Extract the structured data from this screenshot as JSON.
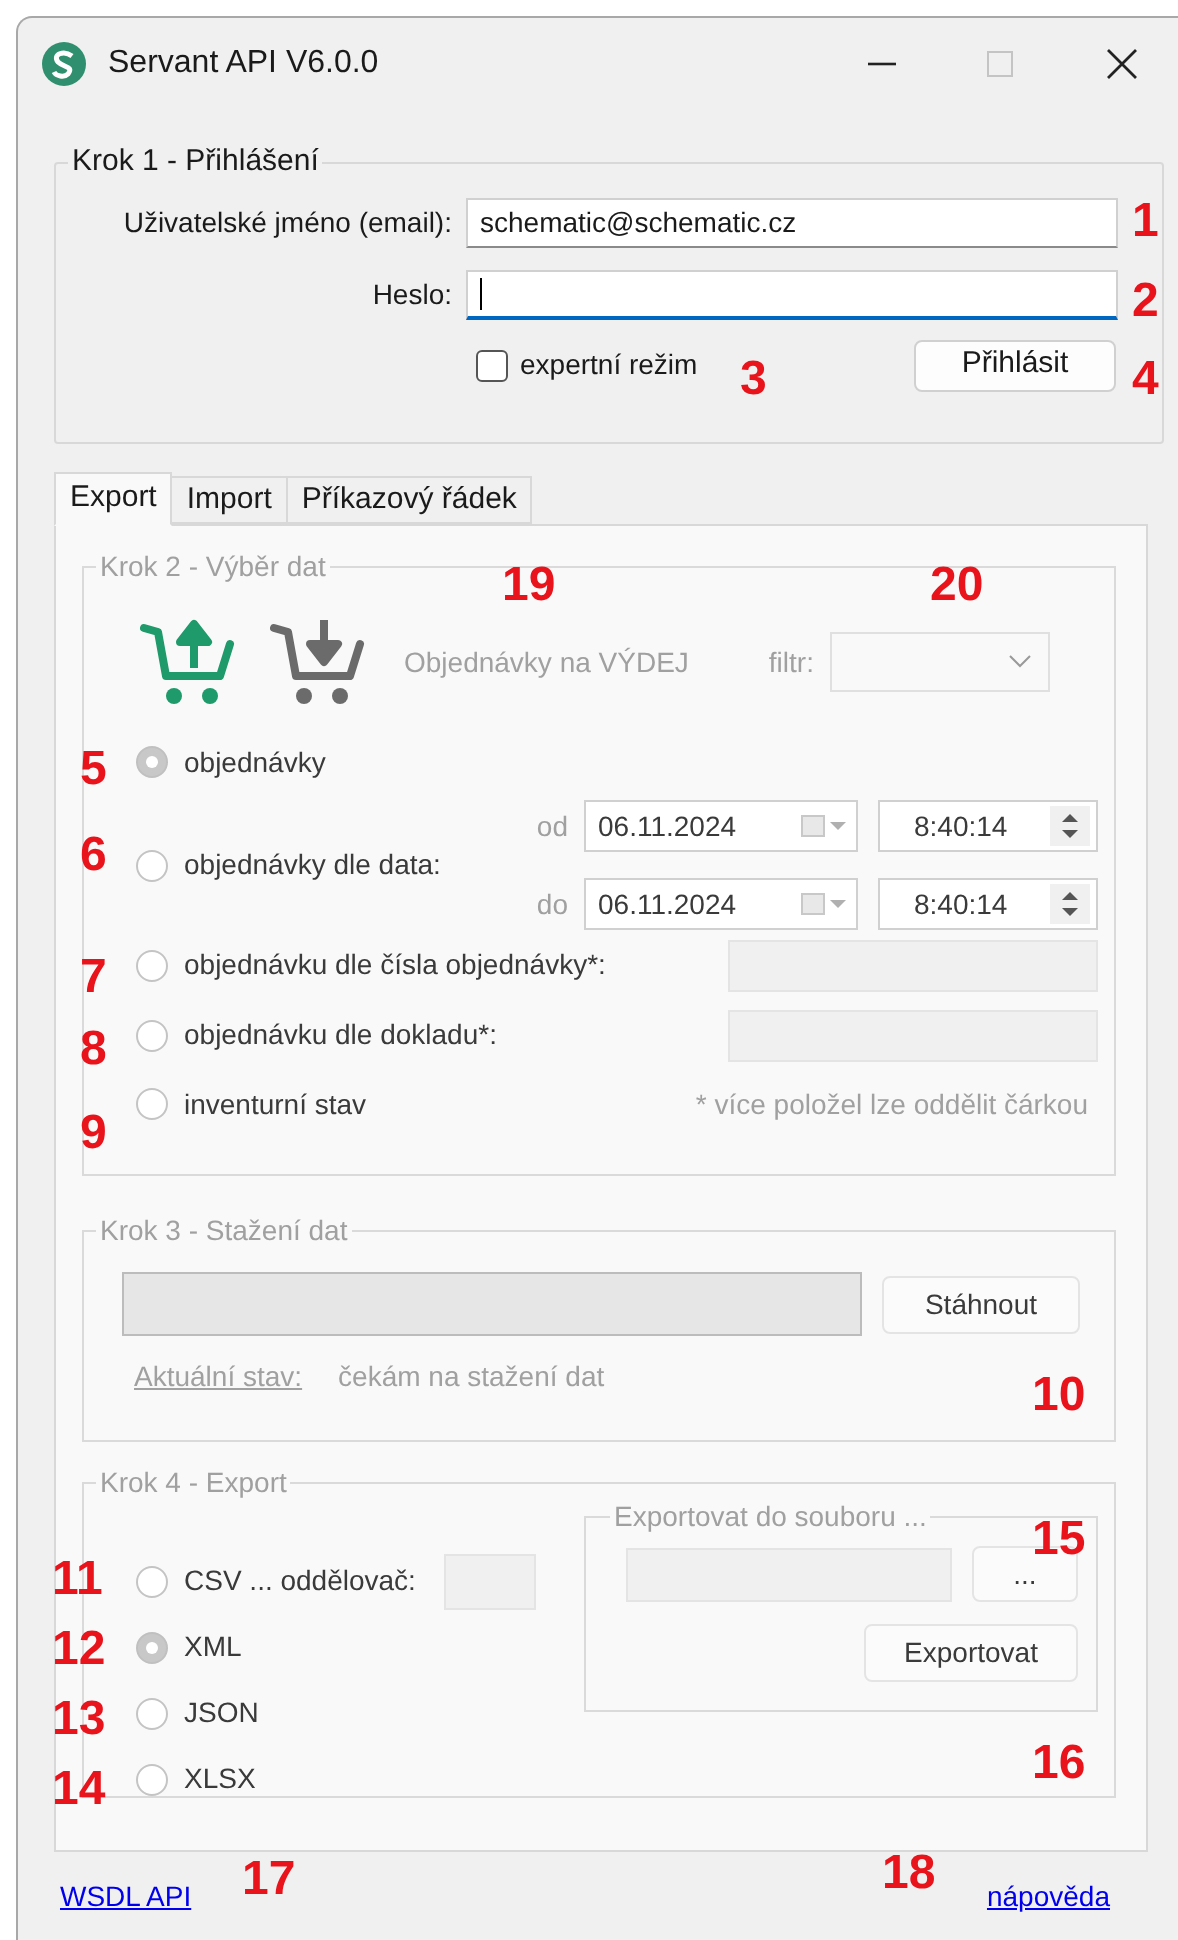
{
  "window": {
    "title": "Servant API V6.0.0"
  },
  "login": {
    "legend": "Krok 1 - Přihlášení",
    "username_label": "Uživatelské jméno (email):",
    "username_value": "schematic@schematic.cz",
    "password_label": "Heslo:",
    "password_focused": true,
    "expert": {
      "label": "expertní režim",
      "checked": false
    },
    "login_button": "Přihlásit"
  },
  "tabs": [
    {
      "label": "Export",
      "selected": true
    },
    {
      "label": "Import",
      "selected": false
    },
    {
      "label": "Příkazový řádek",
      "selected": false
    }
  ],
  "step2": {
    "legend": "Krok 2 - Výběr dat",
    "cart_buttons": [
      {
        "kind": "up",
        "selected": true
      },
      {
        "kind": "down",
        "selected": false
      }
    ],
    "order_type": "Objednávky na VÝDEJ",
    "filter_label": "filtr:",
    "options": [
      {
        "kind": "plain",
        "label": "objednávky",
        "selected": true
      },
      {
        "kind": "date_range",
        "label": "objednávky dle data:",
        "selected": false
      },
      {
        "kind": "text_input",
        "label": "objednávku dle čísla objednávky*:",
        "selected": false
      },
      {
        "kind": "text_input",
        "label": "objednávku dle dokladu*:",
        "selected": false
      },
      {
        "kind": "note",
        "label": "inventurní stav",
        "selected": false
      }
    ],
    "range": [
      {
        "label": "od",
        "date": "06.11.2024",
        "time": "8:40:14"
      },
      {
        "label": "do",
        "date": "06.11.2024",
        "time": "8:40:14"
      }
    ],
    "note": "* více položel lze oddělit čárkou"
  },
  "step3": {
    "legend": "Krok 3 - Stažení dat",
    "level": 0,
    "download_button": "Stáhnout",
    "status_link": "Aktuální stav:",
    "status_text": "čekám na stažení dat"
  },
  "step4": {
    "legend": "Krok 4 - Export",
    "formats": [
      {
        "kind": "csv",
        "label": "CSV ... oddělovač:",
        "selected": false
      },
      {
        "kind": "plain",
        "label": "XML",
        "selected": true
      },
      {
        "kind": "plain",
        "label": "JSON",
        "selected": false
      },
      {
        "kind": "plain",
        "label": "XLSX",
        "selected": false
      }
    ],
    "file_group": {
      "legend": "Exportovat do souboru ...",
      "browse_button": "...",
      "export_button": "Exportovat"
    }
  },
  "footer": {
    "left_link": "WSDL API",
    "right_link": "nápověda"
  },
  "annotations": [
    "1",
    "2",
    "3",
    "4",
    "5",
    "6",
    "7",
    "8",
    "9",
    "10",
    "11",
    "12",
    "13",
    "14",
    "15",
    "16",
    "17",
    "18",
    "19",
    "20"
  ]
}
